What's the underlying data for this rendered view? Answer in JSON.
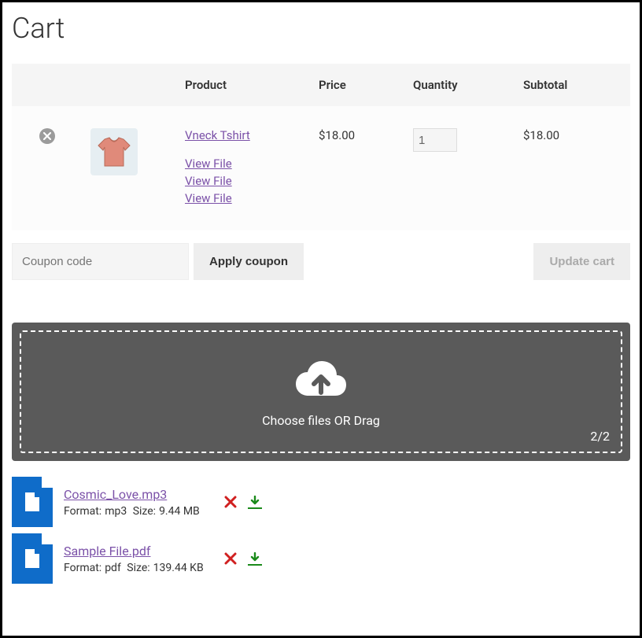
{
  "page": {
    "title": "Cart"
  },
  "headers": {
    "product": "Product",
    "price": "Price",
    "quantity": "Quantity",
    "subtotal": "Subtotal"
  },
  "item": {
    "name": "Vneck Tshirt",
    "price": "$18.00",
    "subtotal": "$18.00",
    "quantity": "1",
    "view_file_1": "View File",
    "view_file_2": "View File",
    "view_file_3": "View File"
  },
  "coupon": {
    "placeholder": "Coupon code"
  },
  "buttons": {
    "apply_coupon": "Apply coupon",
    "update_cart": "Update cart"
  },
  "dropzone": {
    "text": "Choose files OR Drag",
    "counter": "2/2"
  },
  "files": [
    {
      "name": "Cosmic_Love.mp3",
      "format_label": "Format:",
      "format": "mp3",
      "size_label": "Size:",
      "size": "9.44 MB"
    },
    {
      "name": "Sample File.pdf",
      "format_label": "Format:",
      "format": "pdf",
      "size_label": "Size:",
      "size": "139.44 KB"
    }
  ]
}
